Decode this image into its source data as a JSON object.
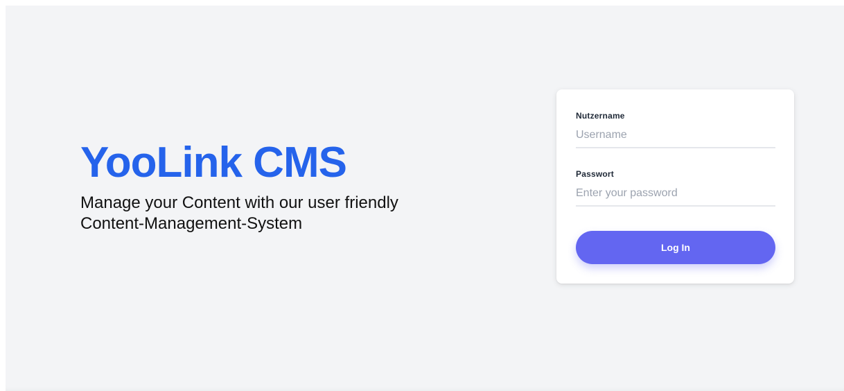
{
  "hero": {
    "title": "YooLink CMS",
    "tagline": "Manage your Content with our user friendly Content-Management-System"
  },
  "login": {
    "username_label": "Nutzername",
    "username_placeholder": "Username",
    "username_value": "",
    "password_label": "Passwort",
    "password_placeholder": "Enter your password",
    "password_value": "",
    "submit_label": "Log In"
  },
  "colors": {
    "brand": "#2563eb",
    "button": "#6366f1",
    "background": "#f3f4f6"
  }
}
